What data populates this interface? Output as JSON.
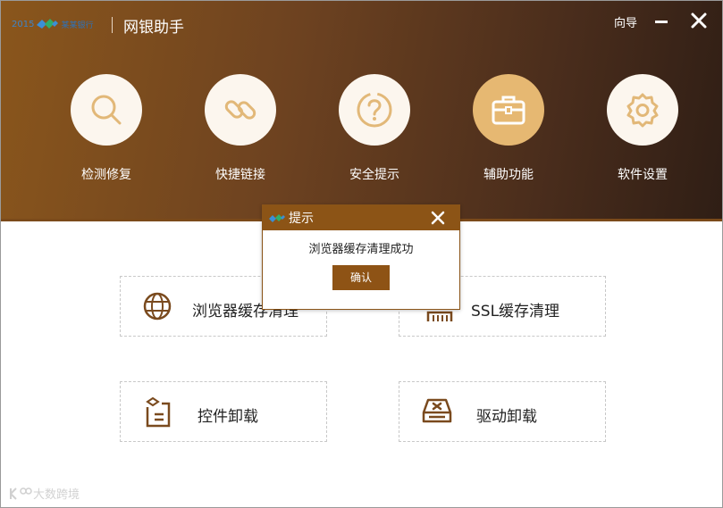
{
  "window": {
    "app_title": "网银助手",
    "guide_label": "向导"
  },
  "logo": {
    "small_text": "2015",
    "bank_name": "某某银行"
  },
  "nav": {
    "items": [
      {
        "label": "检测修复",
        "icon": "search-icon"
      },
      {
        "label": "快捷链接",
        "icon": "link-icon"
      },
      {
        "label": "安全提示",
        "icon": "question-icon"
      },
      {
        "label": "辅助功能",
        "icon": "toolbox-icon",
        "active": true
      },
      {
        "label": "软件设置",
        "icon": "gear-icon"
      }
    ]
  },
  "tools": {
    "browser_cache": "浏览器缓存清理",
    "ssl_cache": "SSL缓存清理",
    "control_uninstall": "控件卸载",
    "driver_uninstall": "驱动卸载"
  },
  "dialog": {
    "title": "提示",
    "message": "浏览器缓存清理成功",
    "ok_label": "确认"
  },
  "watermark": {
    "text": "大数跨境"
  },
  "colors": {
    "brand": "#8c5416",
    "active_circle": "#e6b872",
    "header_dark": "#2f1e15"
  }
}
